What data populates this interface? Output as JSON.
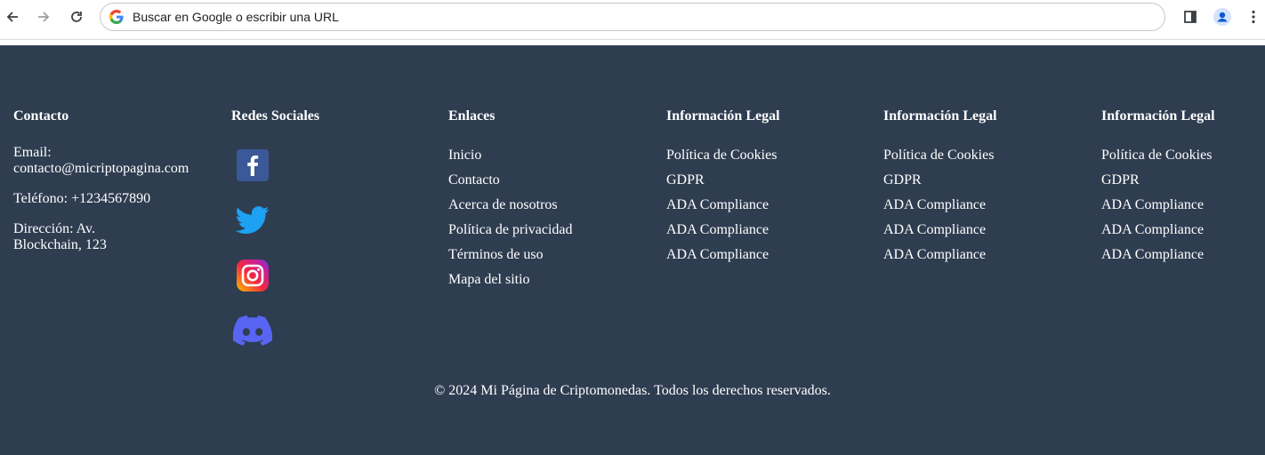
{
  "browser": {
    "address_placeholder": "Buscar en Google o escribir una URL"
  },
  "footer": {
    "contact": {
      "heading": "Contacto",
      "email_label": "Email:",
      "email": "contacto@micriptopagina.com",
      "phone": "Teléfono: +1234567890",
      "address_line1": "Dirección: Av.",
      "address_line2": "Blockchain, 123"
    },
    "social": {
      "heading": "Redes Sociales",
      "items": [
        "facebook-icon",
        "twitter-icon",
        "instagram-icon",
        "discord-icon"
      ]
    },
    "links": {
      "heading": "Enlaces",
      "items": [
        "Inicio",
        "Contacto",
        "Acerca de nosotros",
        "Política de privacidad",
        "Términos de uso",
        "Mapa del sitio"
      ]
    },
    "legal1": {
      "heading": "Información Legal",
      "items": [
        "Política de Cookies",
        "GDPR",
        "ADA Compliance",
        "ADA Compliance",
        "ADA Compliance"
      ]
    },
    "legal2": {
      "heading": "Información Legal",
      "items": [
        "Política de Cookies",
        "GDPR",
        "ADA Compliance",
        "ADA Compliance",
        "ADA Compliance"
      ]
    },
    "legal3": {
      "heading": "Información Legal",
      "items": [
        "Política de Cookies",
        "GDPR",
        "ADA Compliance",
        "ADA Compliance",
        "ADA Compliance"
      ]
    },
    "copyright": "© 2024 Mi Página de Criptomonedas. Todos los derechos reservados."
  },
  "colors": {
    "footer_bg": "#2e3d50",
    "facebook": "#3b5998",
    "twitter": "#1da1f2",
    "discord": "#5865f2"
  }
}
